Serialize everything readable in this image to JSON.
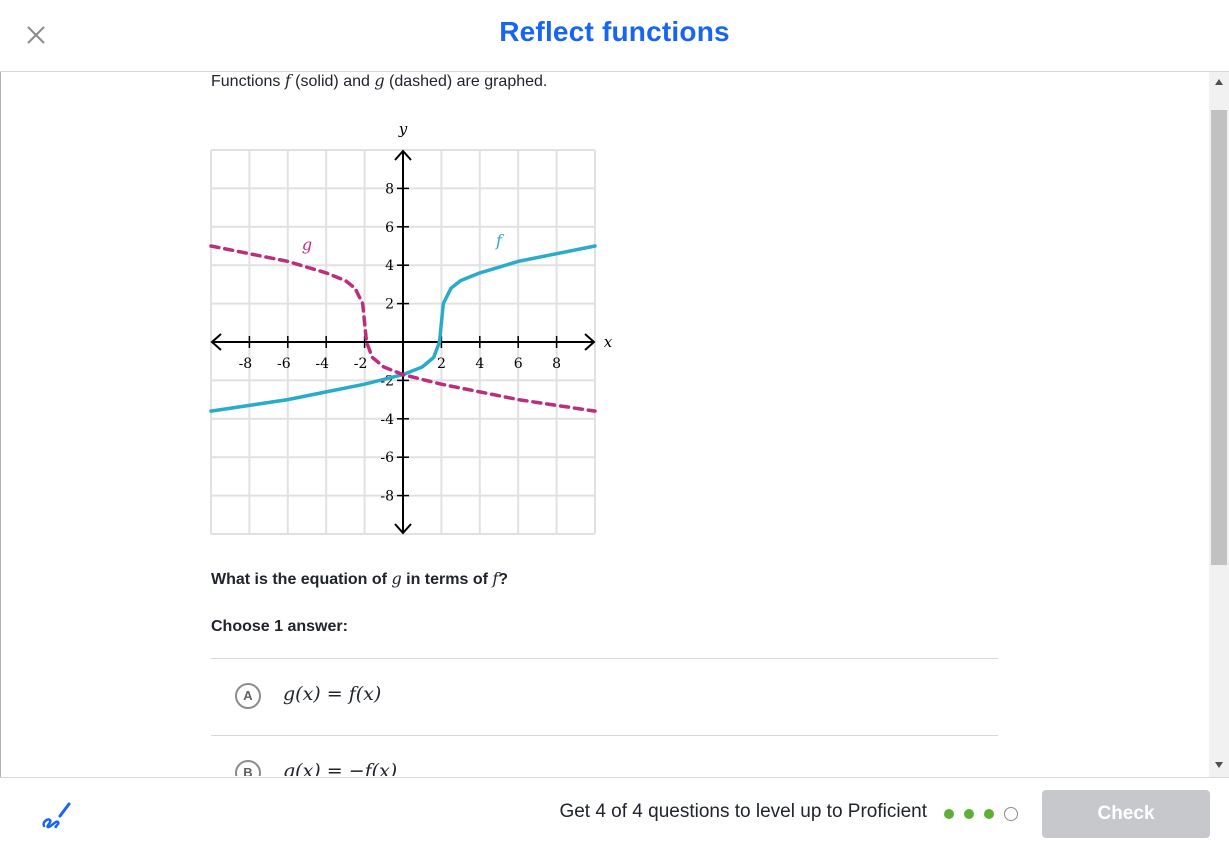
{
  "header": {
    "title": "Reflect functions"
  },
  "prompt": {
    "pre": "Functions ",
    "f_symbol": "f",
    "mid": " (solid) and ",
    "g_symbol": "g",
    "post": " (dashed) are graphed."
  },
  "chart_data": {
    "type": "line",
    "xlabel": "x",
    "ylabel": "y",
    "xlim": [
      -10,
      10
    ],
    "ylim": [
      -10,
      10
    ],
    "grid": true,
    "x_tick_labels": [
      "-8",
      "-6",
      "-4",
      "-2",
      "2",
      "4",
      "6",
      "8"
    ],
    "y_tick_labels": [
      "8",
      "6",
      "4",
      "2",
      "-2",
      "-4",
      "-6",
      "-8"
    ],
    "series": [
      {
        "name": "f",
        "style": "solid",
        "color": "#29abca",
        "points": [
          [
            -10,
            -3.6
          ],
          [
            -8,
            -3.3
          ],
          [
            -6,
            -3.0
          ],
          [
            -4,
            -2.6
          ],
          [
            -2,
            -2.2
          ],
          [
            0,
            -1.7
          ],
          [
            1,
            -1.3
          ],
          [
            1.6,
            -0.8
          ],
          [
            1.9,
            0
          ],
          [
            2,
            1.0
          ],
          [
            2.1,
            2.0
          ],
          [
            2.5,
            2.8
          ],
          [
            3,
            3.2
          ],
          [
            4,
            3.6
          ],
          [
            6,
            4.2
          ],
          [
            8,
            4.6
          ],
          [
            10,
            5.0
          ]
        ],
        "label": "f"
      },
      {
        "name": "g",
        "style": "dashed",
        "color": "#bc2d7c",
        "points": [
          [
            -10,
            5.0
          ],
          [
            -8,
            4.6
          ],
          [
            -6,
            4.2
          ],
          [
            -4,
            3.6
          ],
          [
            -3,
            3.2
          ],
          [
            -2.5,
            2.8
          ],
          [
            -2.1,
            2.0
          ],
          [
            -2,
            1.0
          ],
          [
            -1.9,
            0
          ],
          [
            -1.6,
            -0.8
          ],
          [
            -1,
            -1.3
          ],
          [
            0,
            -1.7
          ],
          [
            2,
            -2.2
          ],
          [
            4,
            -2.6
          ],
          [
            6,
            -3.0
          ],
          [
            8,
            -3.3
          ],
          [
            10,
            -3.6
          ]
        ],
        "label": "g"
      }
    ]
  },
  "question": {
    "pre": "What is the equation of ",
    "g_symbol": "g",
    "mid": " in terms of ",
    "f_symbol": "f",
    "post": "?"
  },
  "choose_label": "Choose 1 answer:",
  "choices": [
    {
      "letter": "A",
      "equation": "g(x) = f(x)"
    },
    {
      "letter": "B",
      "equation": "g(x) = −f(x)"
    }
  ],
  "footer": {
    "level_text": "Get 4 of 4 questions to level up to Proficient",
    "progress": {
      "completed": 3,
      "total": 4
    },
    "check_label": "Check"
  },
  "colors": {
    "title_blue": "#1865f2",
    "progress_green": "#5bb035",
    "f_curve": "#29abca",
    "g_curve": "#bc2d7c"
  }
}
